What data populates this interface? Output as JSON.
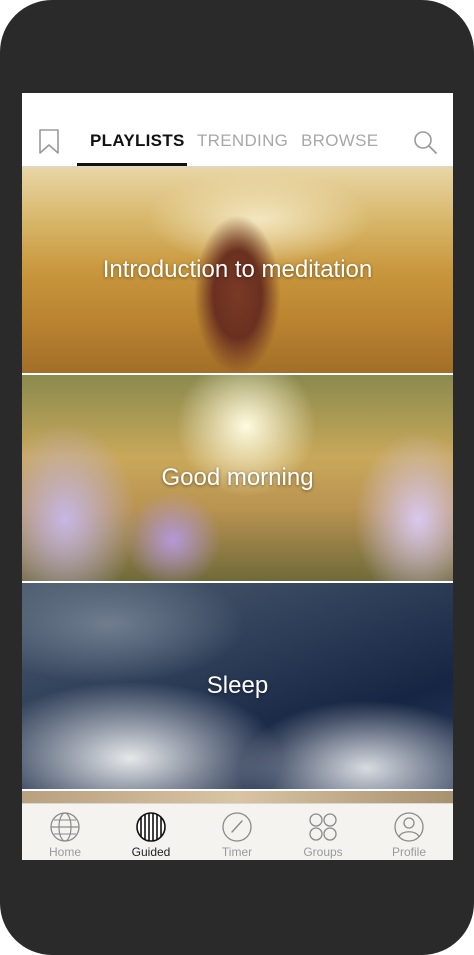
{
  "tabs": {
    "playlists": "PLAYLISTS",
    "trending": "TRENDING",
    "browse": "BROWSE"
  },
  "playlists": [
    {
      "title": "Introduction to meditation"
    },
    {
      "title": "Good morning"
    },
    {
      "title": "Sleep"
    }
  ],
  "bottom_nav": {
    "home": "Home",
    "guided": "Guided",
    "timer": "Timer",
    "groups": "Groups",
    "profile": "Profile"
  },
  "colors": {
    "phone_frame": "#2a2a2a",
    "active_text": "#111111",
    "inactive_text": "#a8a8a8",
    "nav_bar": "#f4f3ef"
  }
}
